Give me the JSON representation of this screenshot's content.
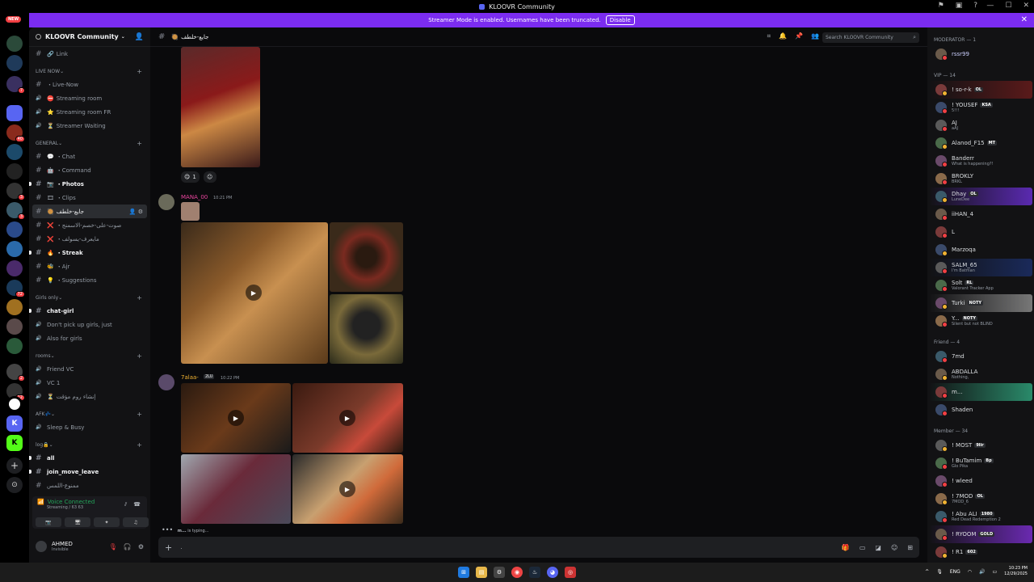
{
  "window": {
    "title": "KLOOVR Community"
  },
  "banner": {
    "text": "Streamer Mode is enabled. Usernames have been truncated.",
    "button": "Disable"
  },
  "rail": {
    "new_label": "NEW",
    "badges": [
      "7",
      "40",
      "3",
      "3",
      "72",
      "2",
      "12"
    ]
  },
  "server": {
    "name": "KLOOVR Community"
  },
  "sidebar": {
    "top_channel": {
      "emoji": "🔗",
      "label": "Link"
    },
    "categories": [
      {
        "name": "LIVE NOW",
        "channels": [
          {
            "emoji": "",
            "label": "・Live-Now",
            "type": "text"
          },
          {
            "emoji": "⛔",
            "label": "Streaming room",
            "type": "voice"
          },
          {
            "emoji": "⭐",
            "label": "Streaming room FR",
            "type": "voice"
          },
          {
            "emoji": "⏳",
            "label": "Streamer Waiting",
            "type": "voice"
          }
        ]
      },
      {
        "name": "GENERAL",
        "channels": [
          {
            "emoji": "💬",
            "label": "・Chat",
            "type": "text"
          },
          {
            "emoji": "🤖",
            "label": "・Command",
            "type": "text"
          },
          {
            "emoji": "📷",
            "label": "・Photos",
            "type": "text",
            "unread": true
          },
          {
            "emoji": "🎞",
            "label": "・Clips",
            "type": "text"
          },
          {
            "emoji": "🥘",
            "label": "جايع-خلطف",
            "type": "text",
            "active": true
          },
          {
            "emoji": "❌",
            "label": "・صوت-على-خصم-الاسمنج",
            "type": "text"
          },
          {
            "emoji": "❌",
            "label": "・مايعرف-يسولف",
            "type": "text"
          },
          {
            "emoji": "🔥",
            "label": "・Streak",
            "type": "text",
            "unread": true
          },
          {
            "emoji": "🐝",
            "label": "・Ajr",
            "type": "text"
          },
          {
            "emoji": "💡",
            "label": "・Suggestions",
            "type": "text"
          }
        ]
      },
      {
        "name": "Girls only",
        "channels": [
          {
            "emoji": "",
            "label": "chat-girl",
            "type": "text",
            "unread": true
          },
          {
            "emoji": "",
            "label": "Don't pick up girls, just",
            "type": "voice"
          },
          {
            "emoji": "",
            "label": "Also for girls",
            "type": "voice"
          }
        ]
      },
      {
        "name": "rooms",
        "channels": [
          {
            "emoji": "",
            "label": "Friend VC",
            "type": "voice"
          },
          {
            "emoji": "",
            "label": "VC 1",
            "type": "voice"
          },
          {
            "emoji": "⏳",
            "label": "إنشاء روم مؤقت",
            "type": "voice"
          }
        ]
      },
      {
        "name": "AFK💤",
        "channels": [
          {
            "emoji": "",
            "label": "Sleep & Busy",
            "type": "voice"
          }
        ]
      },
      {
        "name": "log🔒",
        "channels": [
          {
            "emoji": "",
            "label": "all",
            "type": "text",
            "unread": true
          },
          {
            "emoji": "",
            "label": "join_move_leave",
            "type": "text",
            "unread": true
          },
          {
            "emoji": "",
            "label": "ممنوع-اللمس",
            "type": "text"
          }
        ]
      }
    ]
  },
  "voice": {
    "status": "Voice Connected",
    "detail": "Streaming / 63 63"
  },
  "user": {
    "name": "AHMED",
    "status": "Invisible"
  },
  "channel_header": {
    "name": "جايع-خلطف"
  },
  "search": {
    "placeholder": "Search KLOOVR Community"
  },
  "messages": [
    {
      "reactions": [
        {
          "emoji": "😋",
          "count": "1"
        }
      ]
    },
    {
      "author": "MANA_00",
      "time": "10:21 PM"
    },
    {
      "author": "7alaa-",
      "tag": "2LU",
      "time": "10:22 PM"
    }
  ],
  "typing": {
    "user": "m...",
    "text": "is typing..."
  },
  "composer": {
    "placeholder": "."
  },
  "members": {
    "groups": [
      {
        "title": "MODERATOR — 1",
        "items": [
          {
            "name": "rssr99",
            "tag": "",
            "status": ""
          }
        ]
      },
      {
        "title": "VIP — 14",
        "items": [
          {
            "name": "! so-r-k",
            "tag": "OL",
            "status": ""
          },
          {
            "name": "! YOUSEF",
            "tag": "KSA",
            "status": "5!!!"
          },
          {
            "name": "AJ",
            "tag": "",
            "status": "aAJ"
          },
          {
            "name": "Alanod_F15",
            "tag": "MT",
            "status": ""
          },
          {
            "name": "Banderr",
            "tag": "",
            "status": "What is happening?!"
          },
          {
            "name": "BROKLY",
            "tag": "",
            "status": "BRKL"
          },
          {
            "name": "Dhay",
            "tag": "OL",
            "status": "LuneDee"
          },
          {
            "name": "iiHAN_4",
            "tag": "",
            "status": ""
          },
          {
            "name": "L",
            "tag": "",
            "status": ""
          },
          {
            "name": "Marzoqa",
            "tag": "",
            "status": ""
          },
          {
            "name": "SALM_65",
            "tag": "",
            "status": "I'm Batman"
          },
          {
            "name": "Solt",
            "tag": "RL",
            "status": "Valorant Tracker App"
          },
          {
            "name": "Turki",
            "tag": "NOTY",
            "status": ""
          },
          {
            "name": "Y...",
            "tag": "NOTY",
            "status": "Silent but not BLIND"
          }
        ]
      },
      {
        "title": "Friend — 4",
        "items": [
          {
            "name": "7md",
            "tag": "",
            "status": ""
          },
          {
            "name": "ABDALLA",
            "tag": "",
            "status": "Nothing,"
          },
          {
            "name": "m...",
            "tag": "",
            "status": ""
          },
          {
            "name": "Shaden",
            "tag": "",
            "status": ""
          }
        ]
      },
      {
        "title": "Member — 34",
        "items": [
          {
            "name": "! MOST",
            "tag": "9lir",
            "status": ""
          },
          {
            "name": "! BuTamim",
            "tag": "Bp",
            "status": "Glo Pika"
          },
          {
            "name": "! wleed",
            "tag": "",
            "status": ""
          },
          {
            "name": "! 7MOD",
            "tag": "OL",
            "status": "7MOD_6"
          },
          {
            "name": "! Abu ALI",
            "tag": "1980",
            "status": "Red Dead Redemption 2"
          },
          {
            "name": "! RYOOM",
            "tag": "GOLD",
            "status": ""
          },
          {
            "name": "! R1",
            "tag": "602",
            "status": ""
          }
        ]
      }
    ]
  },
  "taskbar": {
    "lang": "ENG",
    "time": "10:23 PM",
    "date": "12/29/2025"
  }
}
